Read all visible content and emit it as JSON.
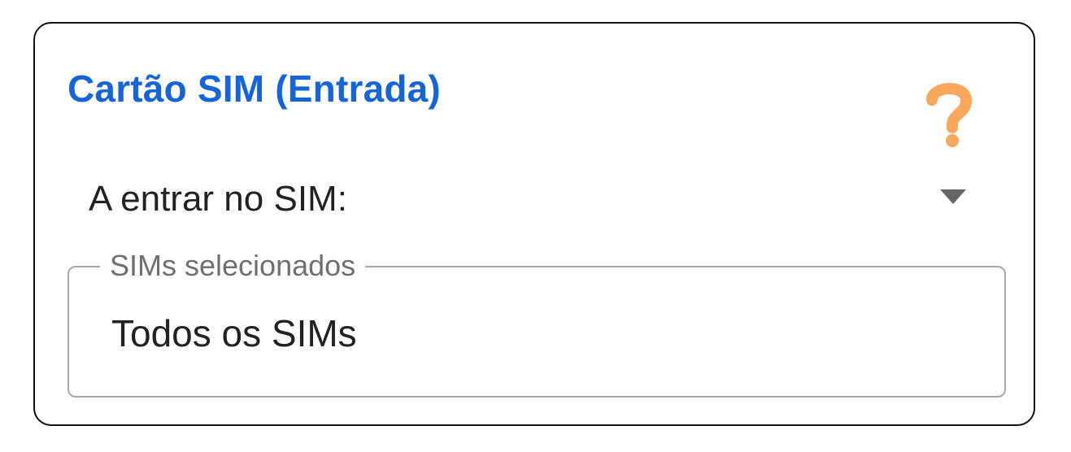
{
  "panel": {
    "title": "Cartão SIM (Entrada)",
    "help_icon": "question-mark-icon",
    "accent_color": "#1565d8",
    "help_color": "#f9a85b"
  },
  "dropdown": {
    "label": "A entrar no SIM:",
    "icon": "caret-down-icon"
  },
  "sim_field": {
    "legend": "SIMs selecionados",
    "value": "Todos os SIMs"
  }
}
